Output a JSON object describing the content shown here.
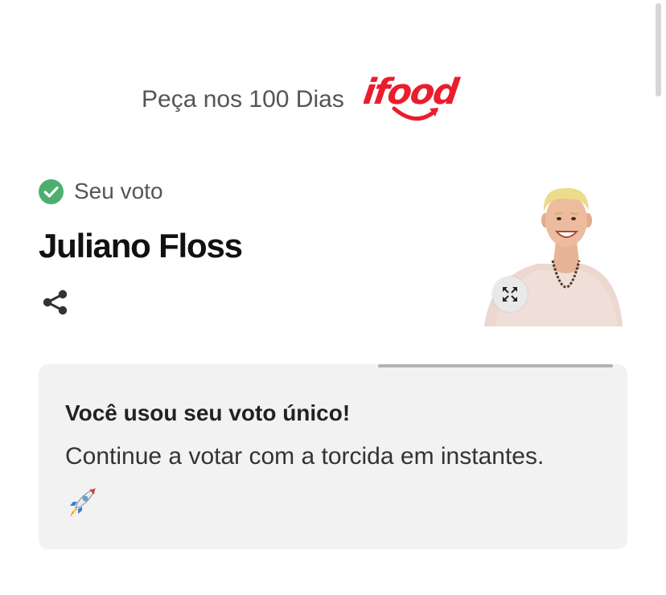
{
  "sponsor": {
    "text": "Peça nos 100 Dias",
    "logo_text": "ifood",
    "brand_color": "#ea1d2c"
  },
  "vote": {
    "status_icon": "check-circle-icon",
    "status_color": "#4caf6e",
    "label": "Seu voto",
    "candidate_name": "Juliano Floss",
    "share_icon": "share-icon",
    "expand_icon": "expand-icon"
  },
  "card": {
    "progress": 1.0,
    "title": "Você usou seu voto único!",
    "text": "Continue a votar com a torcida em instantes.",
    "emoji": "rocket-emoji"
  }
}
